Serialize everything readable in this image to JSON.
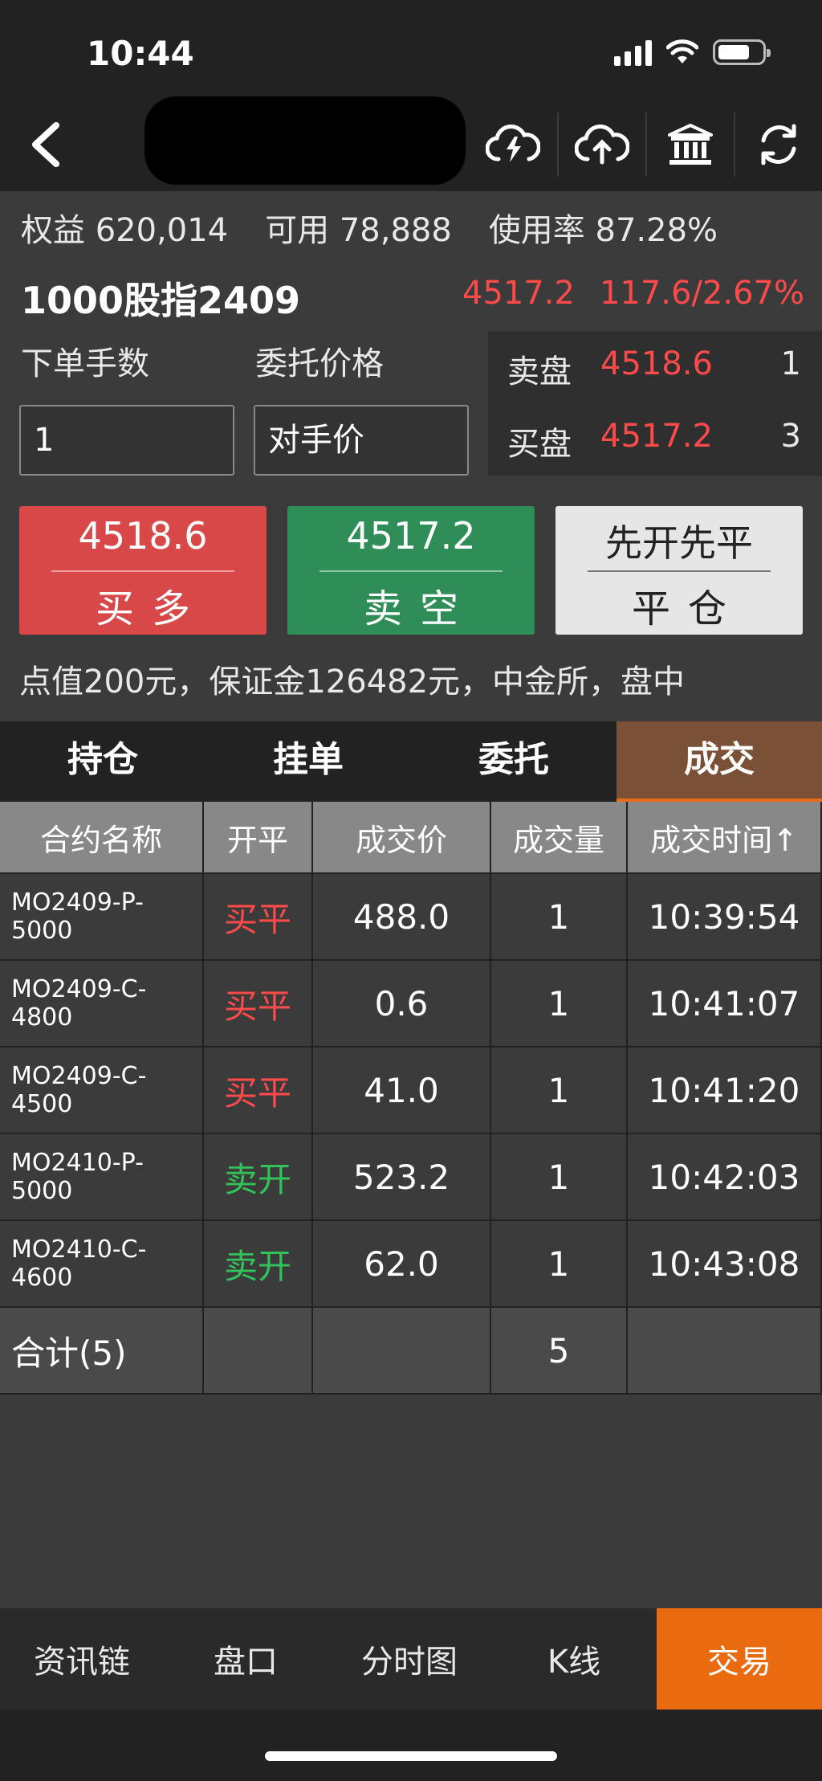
{
  "status_bar": {
    "time": "10:44"
  },
  "nav": {
    "icons": [
      "cloud-lightning-icon",
      "cloud-upload-icon",
      "bank-icon",
      "refresh-icon"
    ]
  },
  "account": {
    "equity": "权益 620,014",
    "available": "可用 78,888",
    "usage": "使用率 87.28%"
  },
  "contract": {
    "name": "1000股指2409",
    "last_price": "4517.2",
    "change": "117.6/2.67%"
  },
  "order": {
    "qty_label": "下单手数",
    "price_label": "委托价格",
    "qty_value": "1",
    "price_value": "对手价"
  },
  "book": {
    "ask_label": "卖盘",
    "ask_price": "4518.6",
    "ask_qty": "1",
    "bid_label": "买盘",
    "bid_price": "4517.2",
    "bid_qty": "3"
  },
  "buttons": {
    "buy_price": "4518.6",
    "buy_label": "买多",
    "sell_price": "4517.2",
    "sell_label": "卖空",
    "close_mode": "先开先平",
    "close_label": "平仓"
  },
  "info_line": "点值200元，保证金126482元，中金所，盘中",
  "tabs": [
    "持仓",
    "挂单",
    "委托",
    "成交"
  ],
  "table": {
    "headers": [
      "合约名称",
      "开平",
      "成交价",
      "成交量",
      "成交时间↑"
    ],
    "rows": [
      {
        "contract": "MO2409-P-5000",
        "side": "买平",
        "price": "488.0",
        "volume": "1",
        "time": "10:39:54"
      },
      {
        "contract": "MO2409-C-4800",
        "side": "买平",
        "price": "0.6",
        "volume": "1",
        "time": "10:41:07"
      },
      {
        "contract": "MO2409-C-4500",
        "side": "买平",
        "price": "41.0",
        "volume": "1",
        "time": "10:41:20"
      },
      {
        "contract": "MO2410-P-5000",
        "side": "卖开",
        "price": "523.2",
        "volume": "1",
        "time": "10:42:03"
      },
      {
        "contract": "MO2410-C-4600",
        "side": "卖开",
        "price": "62.0",
        "volume": "1",
        "time": "10:43:08"
      }
    ],
    "total_label": "合计(5)",
    "total_volume": "5"
  },
  "bottom_nav": [
    "资讯链",
    "盘口",
    "分时图",
    "K线",
    "交易"
  ],
  "colors": {
    "up": "#ff4a4a",
    "down": "#33c25a",
    "accent": "#ea6a10"
  }
}
